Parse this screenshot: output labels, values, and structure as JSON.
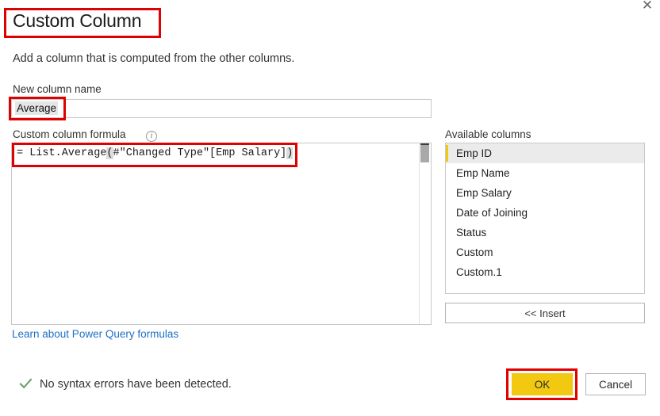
{
  "dialog": {
    "title": "Custom Column",
    "subtitle": "Add a column that is computed from the other columns.",
    "close_icon": "close-icon"
  },
  "new_column": {
    "label": "New column name",
    "value": "Average",
    "placeholder": ""
  },
  "formula": {
    "label": "Custom column formula",
    "info_icon": "i",
    "text_prefix": "= List.Average",
    "open_paren": "(",
    "text_middle": "#\"Changed Type\"[Emp Salary]",
    "close_paren": ")",
    "full_text": "= List.Average(#\"Changed Type\"[Emp Salary])"
  },
  "learn_link": "Learn about Power Query formulas",
  "status": {
    "icon": "checkmark-icon",
    "text": "No syntax errors have been detected.",
    "color": "#6ba368"
  },
  "available_columns": {
    "label": "Available columns",
    "items": [
      {
        "label": "Emp ID",
        "selected": true
      },
      {
        "label": "Emp Name",
        "selected": false
      },
      {
        "label": "Emp Salary",
        "selected": false
      },
      {
        "label": "Date of Joining",
        "selected": false
      },
      {
        "label": "Status",
        "selected": false
      },
      {
        "label": "Custom",
        "selected": false
      },
      {
        "label": "Custom.1",
        "selected": false
      }
    ],
    "insert_label": "<< Insert"
  },
  "footer": {
    "ok_label": "OK",
    "cancel_label": "Cancel"
  },
  "colors": {
    "accent_yellow": "#f2c811",
    "annotation_red": "#e00000",
    "link_blue": "#1f6fc4",
    "success_green": "#6ba368"
  }
}
